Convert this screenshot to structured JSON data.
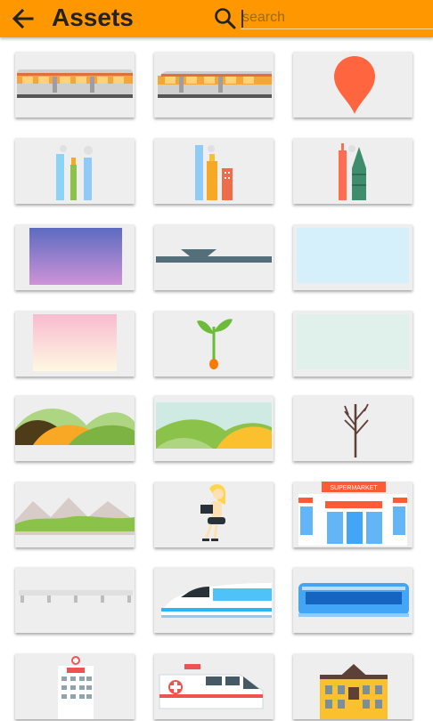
{
  "appbar": {
    "title": "Assets",
    "back_icon": "arrow-back-icon",
    "search_icon": "search-icon",
    "search_placeholder": "search",
    "search_value": "",
    "background_color": "#FF9800"
  },
  "assets": [
    {
      "name": "train-asset"
    },
    {
      "name": "train-asset-2"
    },
    {
      "name": "location-pin-asset"
    },
    {
      "name": "city-towers-blue-asset"
    },
    {
      "name": "city-towers-yellow-asset"
    },
    {
      "name": "city-towers-red-asset"
    },
    {
      "name": "purple-gradient-background"
    },
    {
      "name": "road-bridge-asset"
    },
    {
      "name": "light-blue-background"
    },
    {
      "name": "pink-yellow-gradient-background"
    },
    {
      "name": "sprout-asset"
    },
    {
      "name": "mint-background"
    },
    {
      "name": "hills-landscape-asset"
    },
    {
      "name": "green-hills-sky-asset"
    },
    {
      "name": "bare-tree-asset"
    },
    {
      "name": "mountains-grass-asset"
    },
    {
      "name": "woman-with-laptop-asset"
    },
    {
      "name": "supermarket-asset"
    },
    {
      "name": "elevated-rail-asset"
    },
    {
      "name": "bullet-train-asset"
    },
    {
      "name": "blue-train-asset"
    },
    {
      "name": "hospital-asset"
    },
    {
      "name": "ambulance-asset"
    },
    {
      "name": "school-building-asset"
    }
  ],
  "supermarket_sign": "SUPERMARKET"
}
